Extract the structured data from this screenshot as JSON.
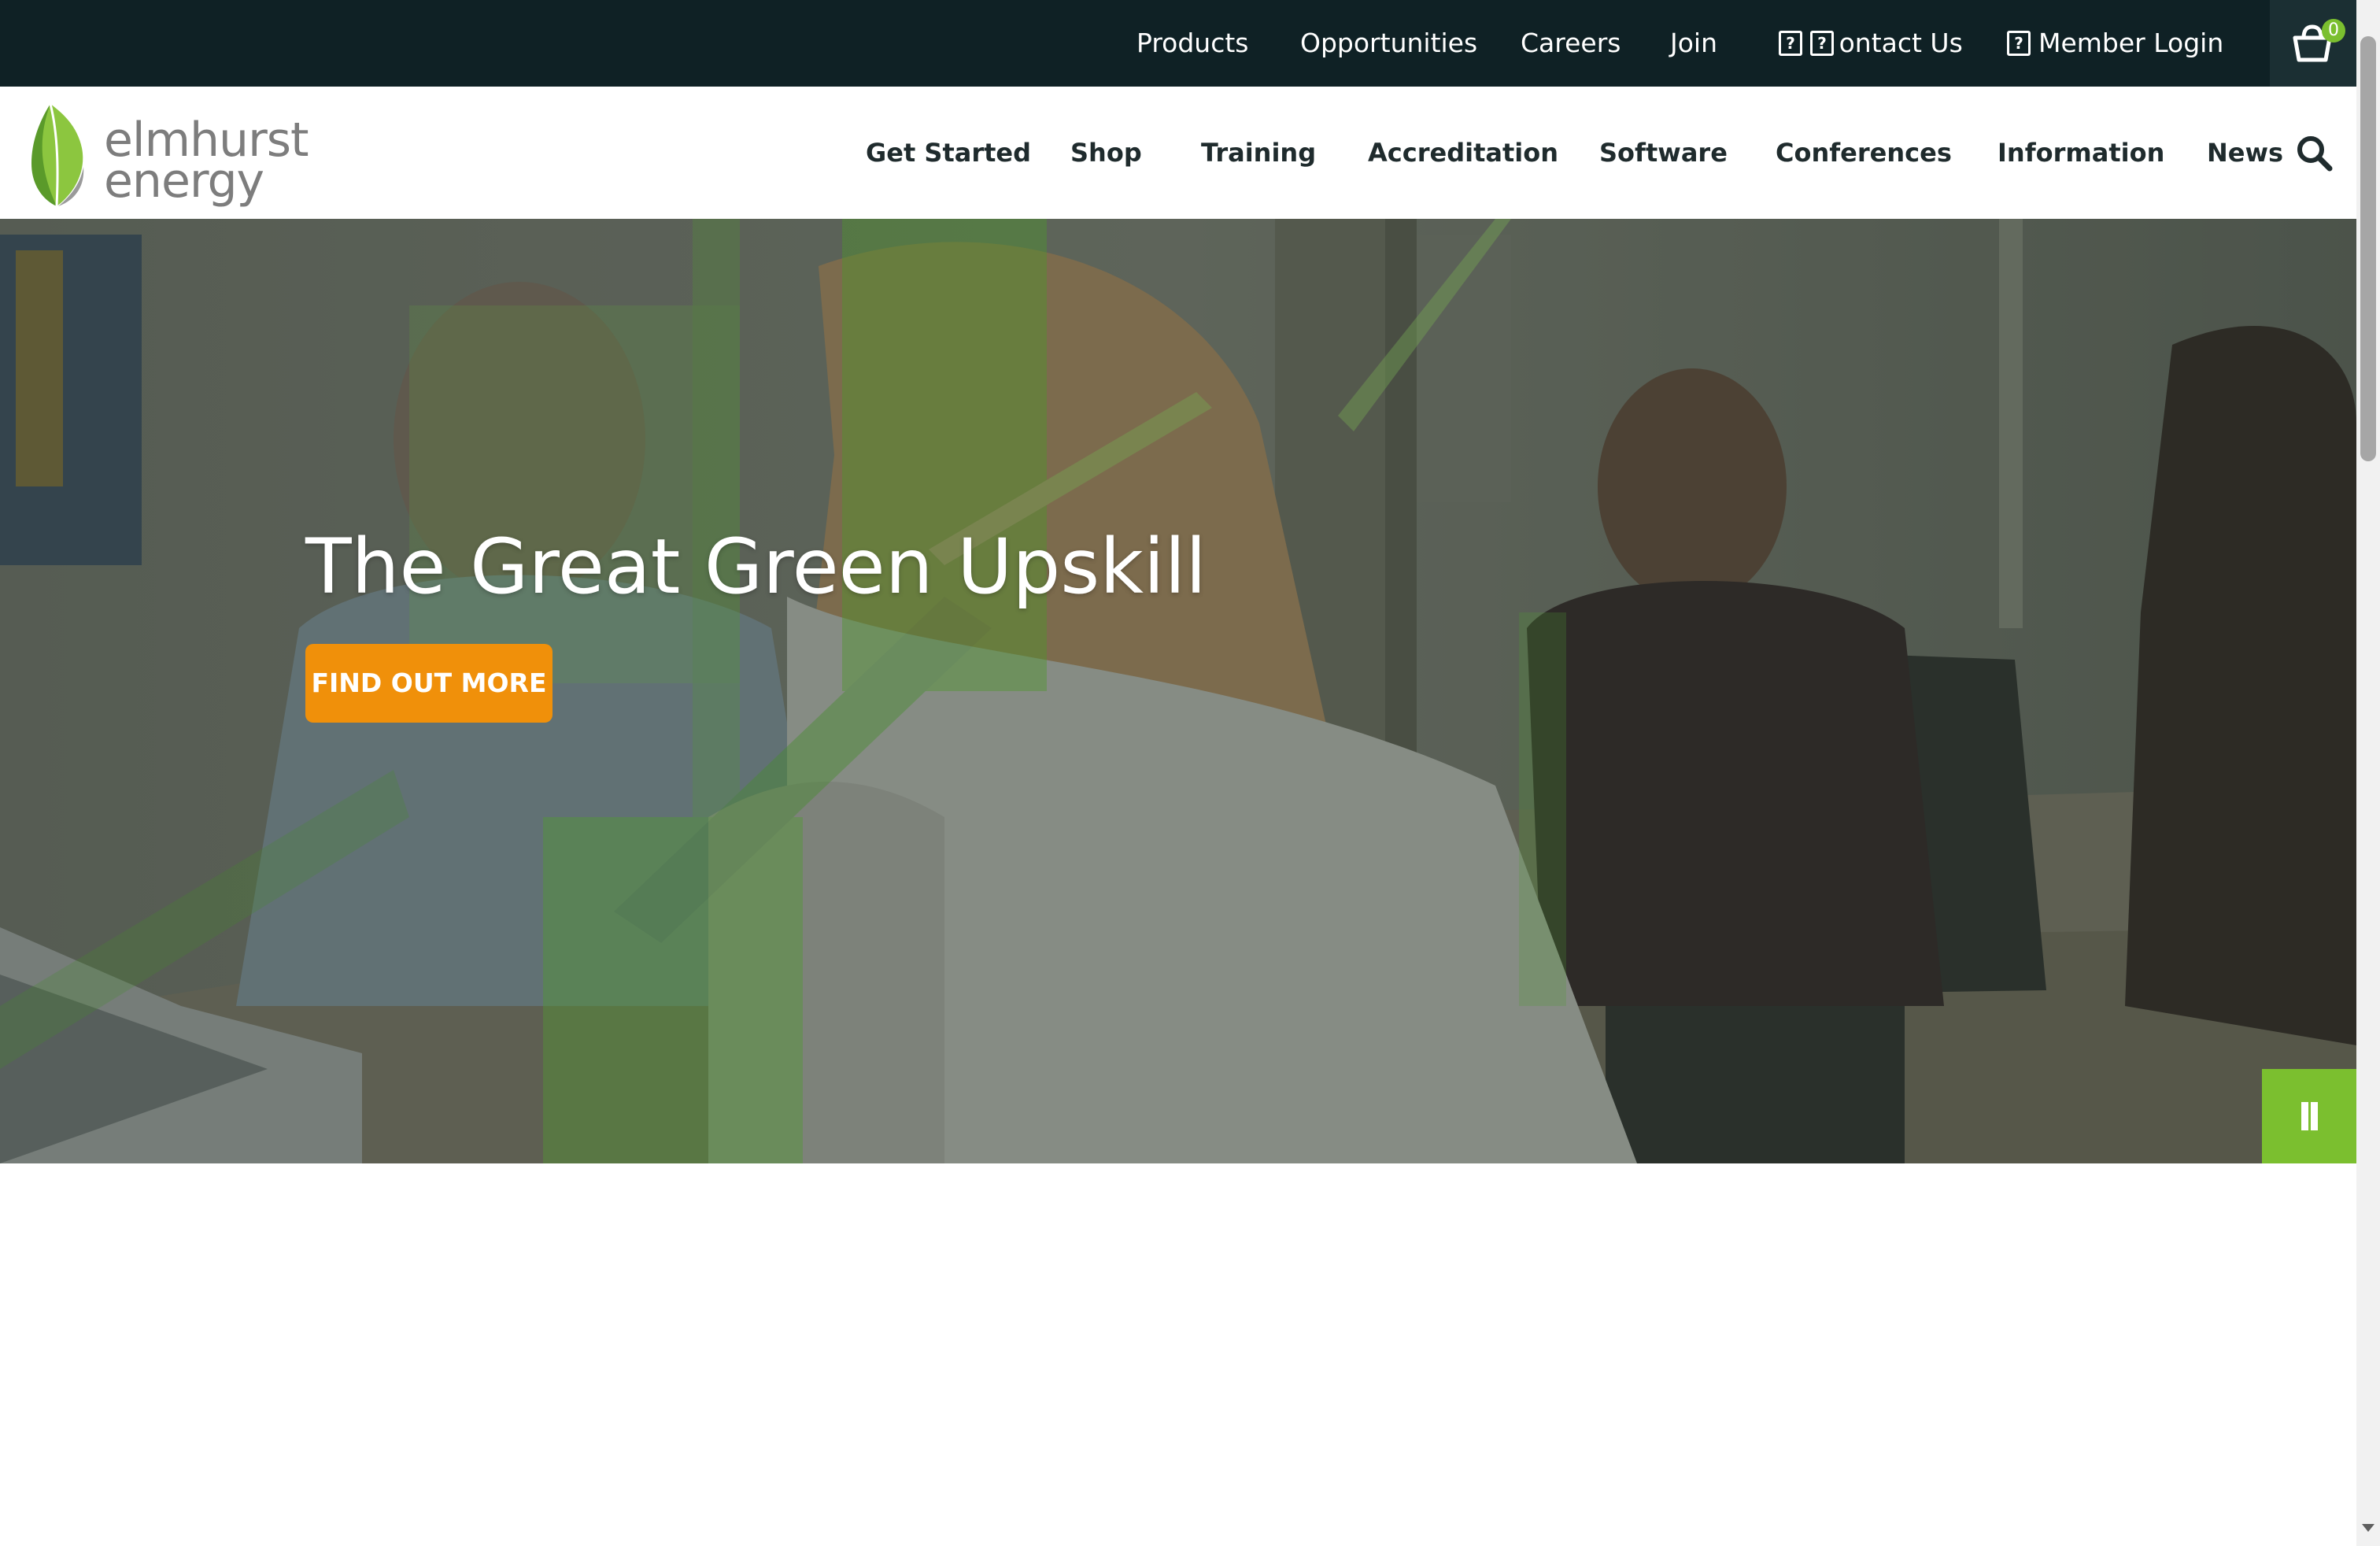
{
  "utility_nav": {
    "items": [
      {
        "label": "Products"
      },
      {
        "label": "Opportunities"
      },
      {
        "label": "Careers"
      },
      {
        "label": "Join"
      },
      {
        "label": " ontact Us",
        "icon": "missing-glyph-icon"
      },
      {
        "label": "Member Login",
        "icon": "missing-glyph-icon"
      }
    ],
    "cart": {
      "icon": "basket-icon",
      "count": "0"
    }
  },
  "logo": {
    "line1": "elmhurst",
    "line2": "energy",
    "icon": "leaf-icon"
  },
  "main_nav": {
    "items": [
      {
        "label": "Get Started"
      },
      {
        "label": "Shop"
      },
      {
        "label": "Training"
      },
      {
        "label": "Accreditation"
      },
      {
        "label": "Software"
      },
      {
        "label": "Conferences"
      },
      {
        "label": "Information"
      },
      {
        "label": "News"
      }
    ],
    "search_icon": "search-icon"
  },
  "hero": {
    "title": "The Great Green Upskill",
    "cta_label": "FIND OUT MORE",
    "pause_icon": "pause-icon"
  },
  "colors": {
    "topbar": "#0f2125",
    "accent_green": "#7bbf2f",
    "cta_orange": "#f0900a",
    "nav_text": "#1f2b2d",
    "logo_text": "#7d7d7d"
  }
}
